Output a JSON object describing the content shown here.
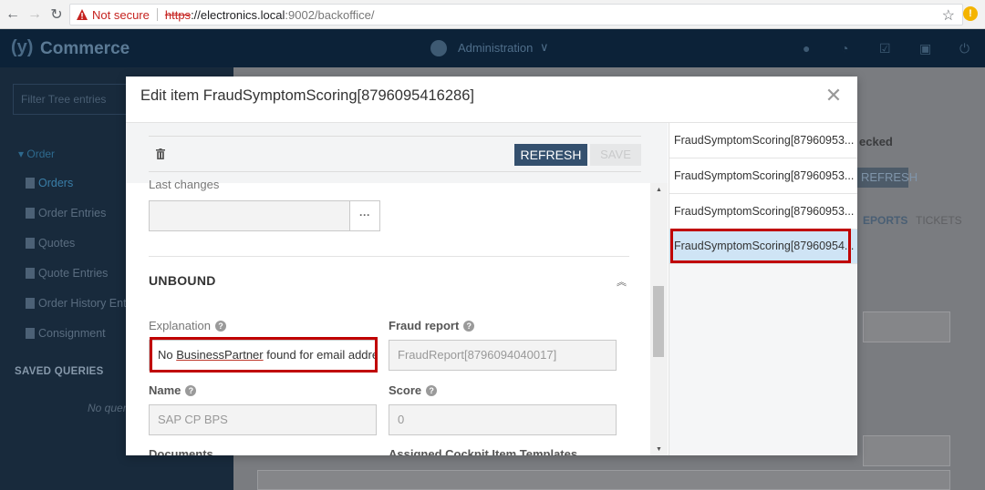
{
  "browser": {
    "security": "Not secure",
    "url_scheme": "https",
    "url_host": "://electronics.local",
    "url_path": ":9002/backoffice/",
    "ext_badge": "!"
  },
  "app": {
    "brand_brace": "(y)",
    "brand_name": "Commerce",
    "perspective": "Administration",
    "filter_placeholder": "Filter Tree entries",
    "nav_group": "Order",
    "nav_items": [
      "Orders",
      "Order Entries",
      "Quotes",
      "Quote Entries",
      "Order History Entries",
      "Consignment"
    ],
    "saved_queries": "SAVED QUERIES",
    "no_queries": "No queries",
    "bg_checked": "ecked",
    "bg_refresh": "REFRESH",
    "bg_tab_reports": "EPORTS",
    "bg_tab_tickets": "TICKETS"
  },
  "modal": {
    "title": "Edit item FraudSymptomScoring[8796095416286]",
    "refresh_label": "REFRESH",
    "save_label": "SAVE",
    "last_changes_label": "Last changes",
    "last_changes_value": "",
    "dots_label": "···",
    "section_title": "UNBOUND",
    "explanation_label": "Explanation",
    "explanation_value_pre": "No ",
    "explanation_value_link": "BusinessPartner",
    "explanation_value_post": " found for email address",
    "fraud_report_label": "Fraud report",
    "fraud_report_value": "FraudReport[8796094040017]",
    "name_label": "Name",
    "name_value": "SAP CP BPS",
    "score_label": "Score",
    "score_value": "0",
    "documents_label": "Documents",
    "templates_label": "Assigned Cockpit Item Templates"
  },
  "list": {
    "items": [
      "FraudSymptomScoring[87960953...",
      "FraudSymptomScoring[87960953...",
      "FraudSymptomScoring[87960953...",
      "FraudSymptomScoring[87960954..."
    ],
    "selected_index": 3
  },
  "icons": {
    "back": "arrow-left-icon",
    "forward": "arrow-right-icon",
    "reload": "reload-icon",
    "warning": "warning-icon",
    "bookmark": "star-icon",
    "trash": "trash-icon",
    "close": "close-icon",
    "help": "help-icon",
    "collapse": "chevron-double-up-icon"
  },
  "colors": {
    "primary_button": "#34506e",
    "header_bg": "#0c2238",
    "selected_row": "#cfe4f5",
    "highlight_box": "#c00000"
  }
}
